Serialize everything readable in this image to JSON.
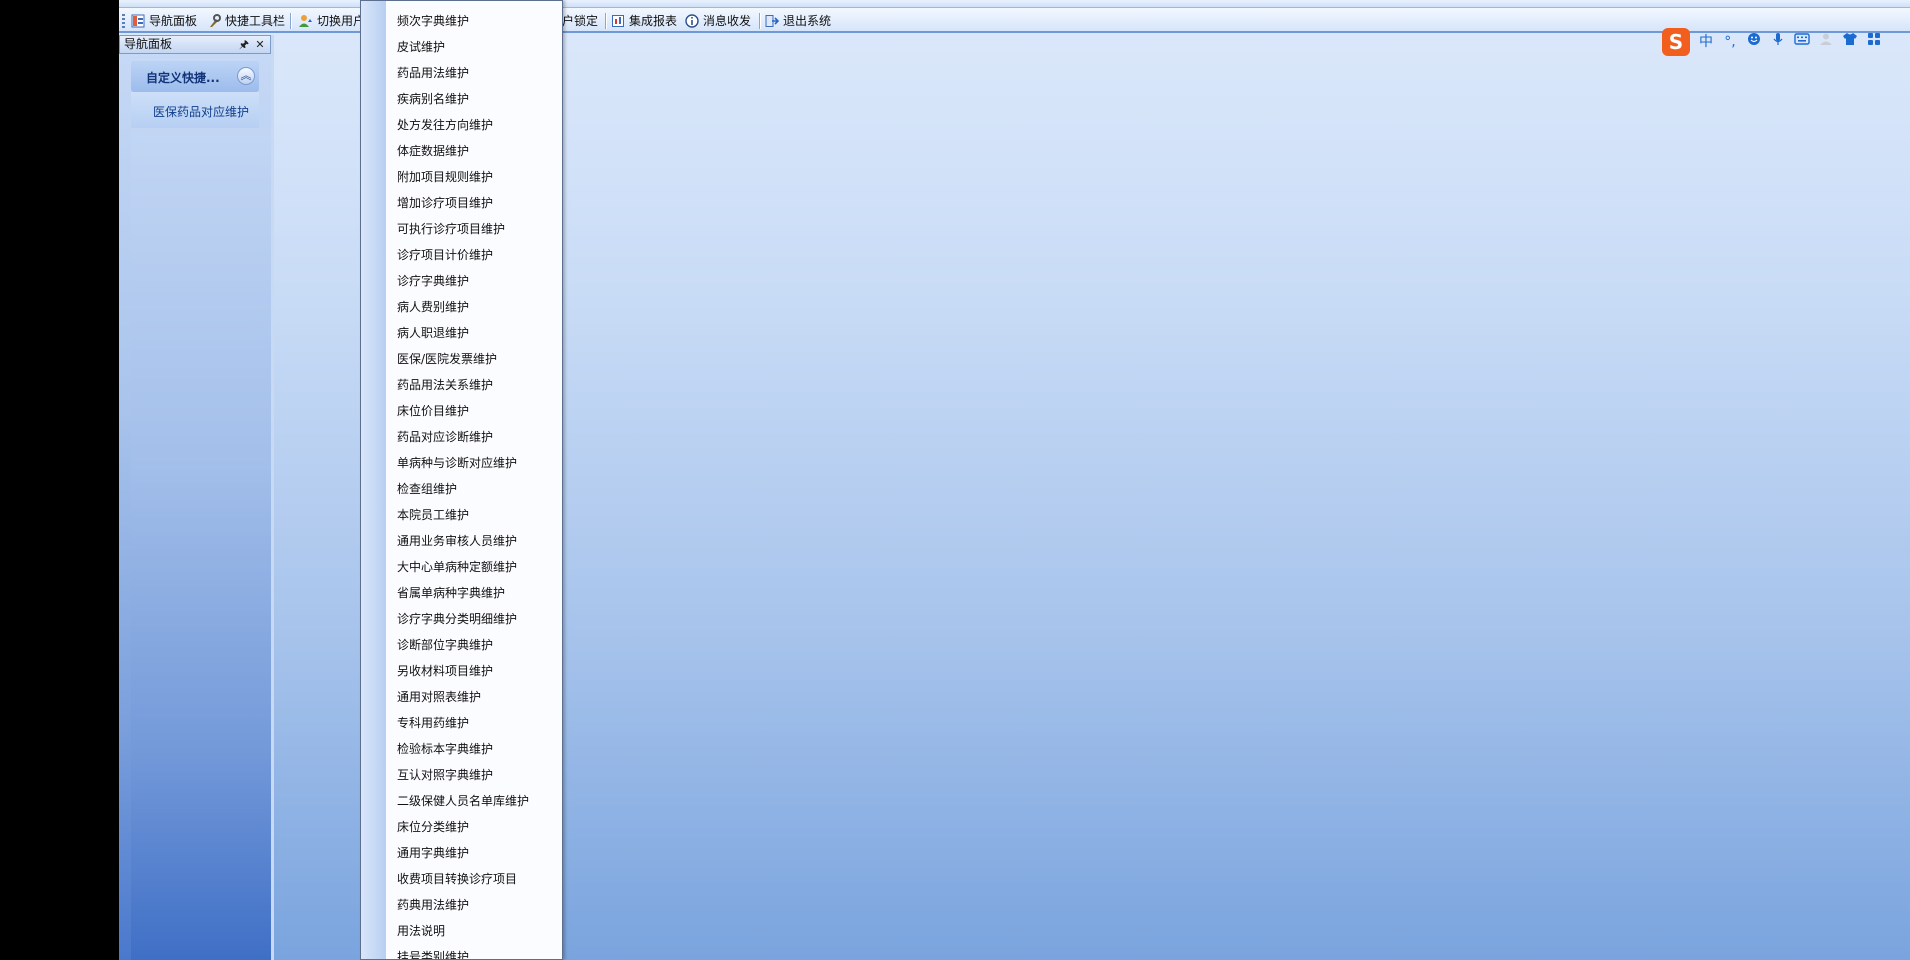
{
  "toolbar": {
    "items": [
      {
        "label": "导航面板",
        "icon": "navigation-panel-icon"
      },
      {
        "label": "快捷工具栏",
        "icon": "quick-toolbar-icon"
      },
      {
        "label": "切换用户",
        "icon": "switch-user-icon"
      },
      {
        "label": "户锁定",
        "icon": "lock-icon"
      },
      {
        "label": "集成报表",
        "icon": "report-icon"
      },
      {
        "label": "消息收发",
        "icon": "message-icon"
      },
      {
        "label": "退出系统",
        "icon": "exit-icon"
      }
    ]
  },
  "nav_panel": {
    "title": "导航面板",
    "pin_icon": "pin-icon",
    "close_icon": "close-icon",
    "group_title": "自定义快捷...",
    "group_link": "医保药品对应维护"
  },
  "dropdown_menu": {
    "items": [
      "频次字典维护",
      "皮试维护",
      "药品用法维护",
      "疾病别名维护",
      "处方发往方向维护",
      "体症数据维护",
      "附加项目规则维护",
      "增加诊疗项目维护",
      "可执行诊疗项目维护",
      "诊疗项目计价维护",
      "诊疗字典维护",
      "病人费别维护",
      "病人职退维护",
      "医保/医院发票维护",
      "药品用法关系维护",
      "床位价目维护",
      "药品对应诊断维护",
      "单病种与诊断对应维护",
      "检查组维护",
      "本院员工维护",
      "通用业务审核人员维护",
      "大中心单病种定额维护",
      "省属单病种字典维护",
      "诊疗字典分类明细维护",
      "诊断部位字典维护",
      "另收材料项目维护",
      "通用对照表维护",
      "专科用药维护",
      "检验标本字典维护",
      "互认对照字典维护",
      "二级保健人员名单库维护",
      "床位分类维护",
      "通用字典维护",
      "收费项目转换诊疗项目",
      "药典用法维护",
      "用法说明",
      "挂号类别维护"
    ]
  },
  "ime_toolbar": {
    "logo": "S",
    "mode": "中",
    "punct": "°,",
    "icons": [
      "emoji-icon",
      "microphone-icon",
      "keyboard-icon",
      "user-icon",
      "skin-icon",
      "grid-icon"
    ]
  },
  "colors": {
    "accent": "#6f98d8",
    "ime_logo": "#f25e1e"
  }
}
